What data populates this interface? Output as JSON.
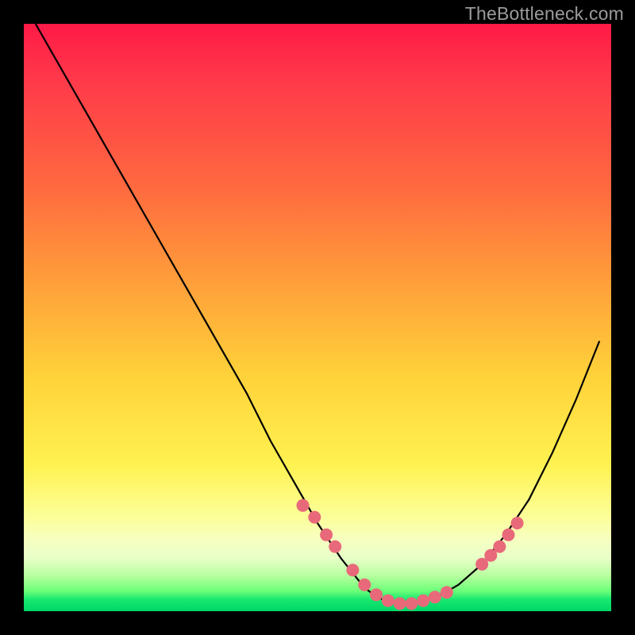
{
  "watermark": "TheBottleneck.com",
  "chart_data": {
    "type": "line",
    "title": "",
    "xlabel": "",
    "ylabel": "",
    "xlim": [
      0,
      100
    ],
    "ylim": [
      0,
      100
    ],
    "series": [
      {
        "name": "curve",
        "x": [
          2,
          6,
          10,
          14,
          18,
          22,
          26,
          30,
          34,
          38,
          42,
          46,
          50,
          54,
          58,
          60,
          62,
          64,
          66,
          70,
          74,
          78,
          82,
          86,
          90,
          94,
          98
        ],
        "y": [
          100,
          93,
          86,
          79,
          72,
          65,
          58,
          51,
          44,
          37,
          29,
          22,
          15,
          9,
          4,
          2.5,
          1.6,
          1.2,
          1.3,
          2.2,
          4.5,
          8,
          13,
          19,
          27,
          36,
          46
        ]
      }
    ],
    "markers": {
      "name": "dots",
      "color": "#e86a7a",
      "radius_px": 8,
      "x": [
        47.5,
        49.5,
        51.5,
        53,
        56,
        58,
        60,
        62,
        64,
        66,
        68,
        70,
        72,
        78,
        79.5,
        81,
        82.5,
        84
      ],
      "y": [
        18,
        16,
        13,
        11,
        7,
        4.5,
        2.8,
        1.8,
        1.3,
        1.3,
        1.8,
        2.4,
        3.2,
        8,
        9.5,
        11,
        13,
        15
      ]
    },
    "gradient_stops": [
      {
        "pos": 0.0,
        "color": "#ff1a47"
      },
      {
        "pos": 0.45,
        "color": "#ffa23a"
      },
      {
        "pos": 0.75,
        "color": "#fff250"
      },
      {
        "pos": 0.95,
        "color": "#6eff7a"
      },
      {
        "pos": 1.0,
        "color": "#00d768"
      }
    ]
  }
}
